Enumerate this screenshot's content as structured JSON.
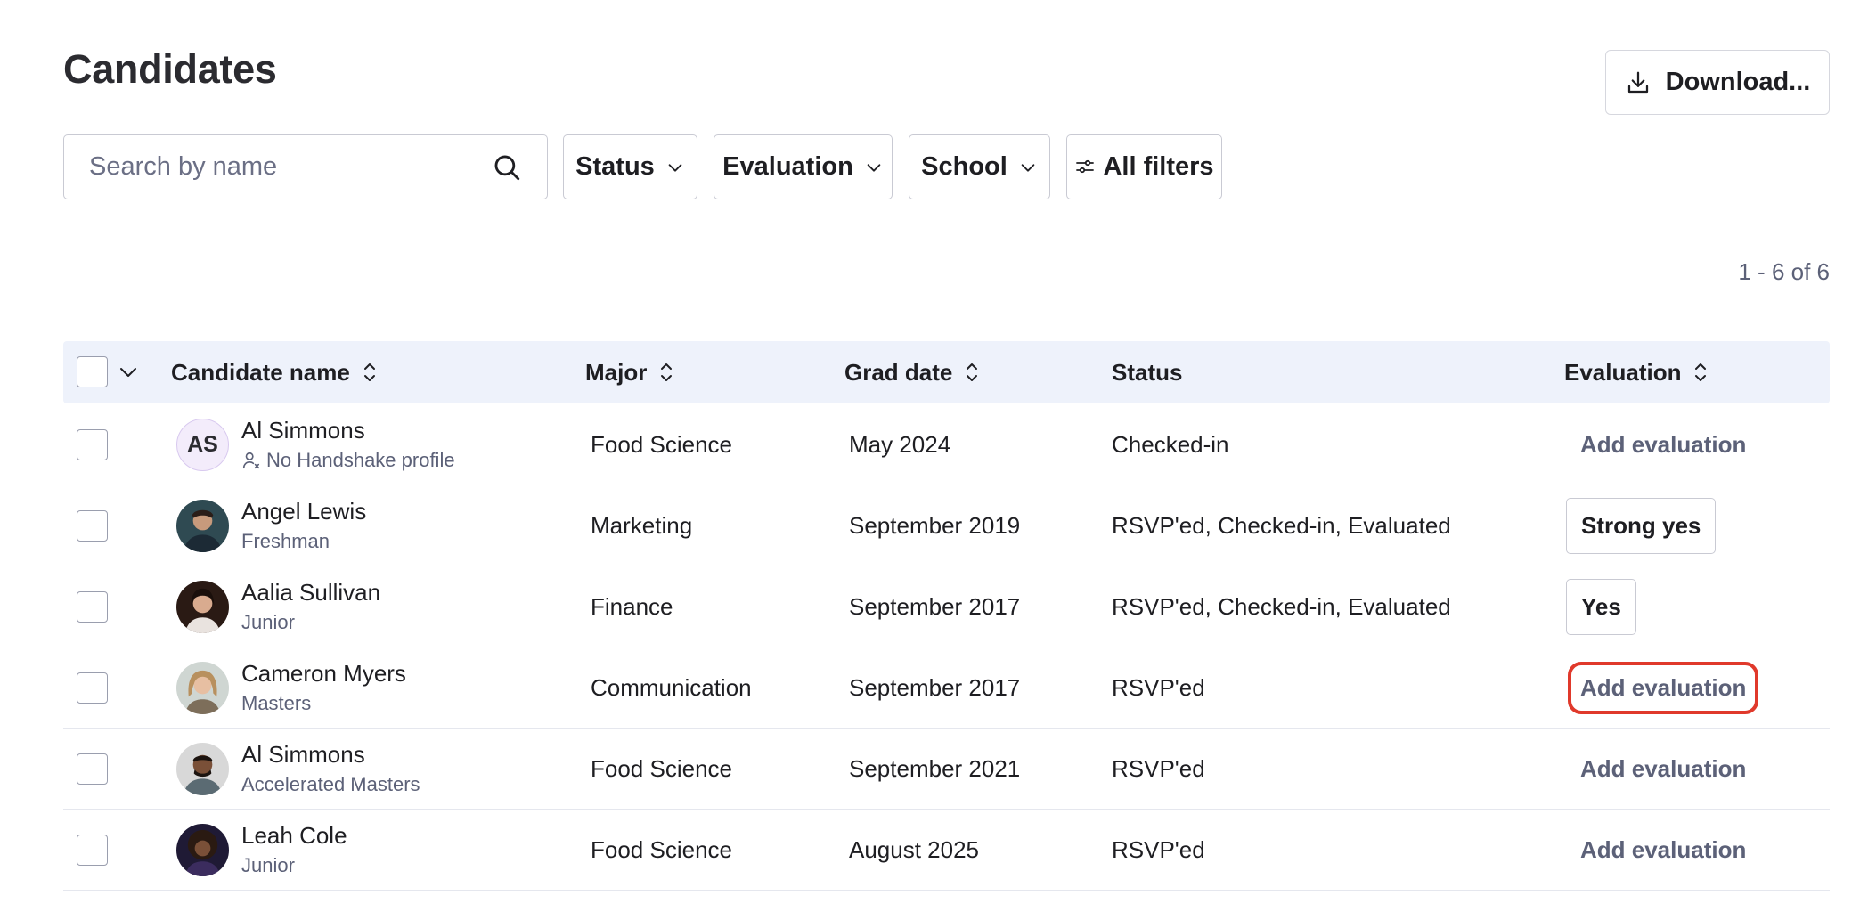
{
  "header": {
    "title": "Candidates",
    "download_label": "Download..."
  },
  "search": {
    "placeholder": "Search by name"
  },
  "filters": {
    "status": "Status",
    "evaluation": "Evaluation",
    "school": "School",
    "all": "All filters"
  },
  "pagination": {
    "range": "1 - 6 of 6"
  },
  "table": {
    "columns": {
      "name": "Candidate name",
      "major": "Major",
      "grad_date": "Grad date",
      "status": "Status",
      "evaluation": "Evaluation"
    },
    "rows": [
      {
        "initials": "AS",
        "name": "Al Simmons",
        "sub": "No Handshake profile",
        "major": "Food Science",
        "grad_date": "May 2024",
        "status": "Checked-in",
        "evaluation": "Add evaluation"
      },
      {
        "name": "Angel Lewis",
        "sub": "Freshman",
        "major": "Marketing",
        "grad_date": "September 2019",
        "status": "RSVP'ed, Checked-in, Evaluated",
        "evaluation": "Strong yes"
      },
      {
        "name": "Aalia Sullivan",
        "sub": "Junior",
        "major": "Finance",
        "grad_date": "September 2017",
        "status": "RSVP'ed, Checked-in, Evaluated",
        "evaluation": "Yes"
      },
      {
        "name": "Cameron Myers",
        "sub": "Masters",
        "major": "Communication",
        "grad_date": "September 2017",
        "status": "RSVP'ed",
        "evaluation": "Add evaluation"
      },
      {
        "name": "Al Simmons",
        "sub": "Accelerated Masters",
        "major": "Food Science",
        "grad_date": "September 2021",
        "status": "RSVP'ed",
        "evaluation": "Add evaluation"
      },
      {
        "name": "Leah Cole",
        "sub": "Junior",
        "major": "Food Science",
        "grad_date": "August 2025",
        "status": "RSVP'ed",
        "evaluation": "Add evaluation"
      }
    ]
  },
  "colors": {
    "header_bg": "#eef2fb",
    "muted_text": "#5c6178",
    "highlight": "#e0392b",
    "border": "#c9cad3"
  }
}
